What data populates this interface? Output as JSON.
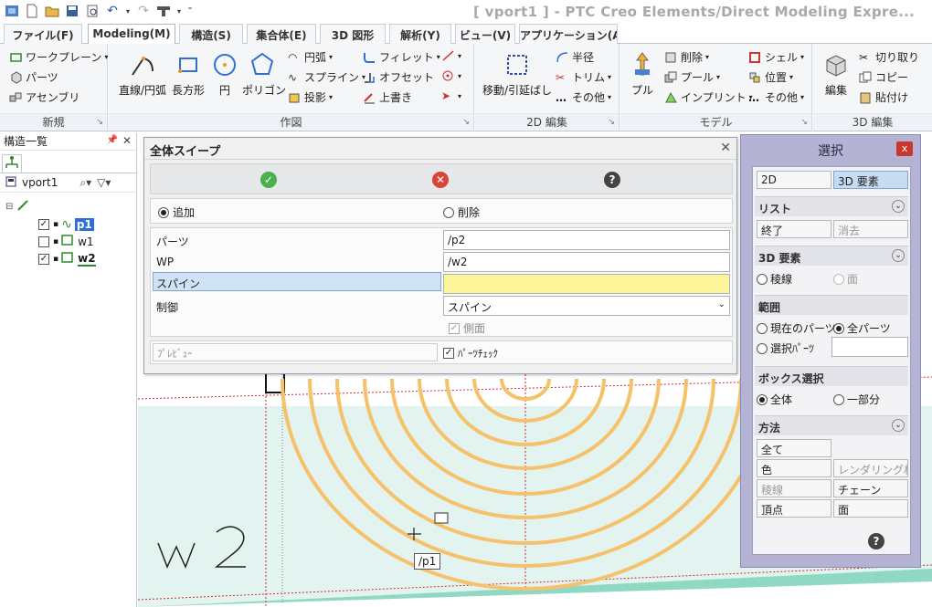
{
  "window": {
    "title": "[ vport1 ] - PTC Creo Elements/Direct Modeling Expre..."
  },
  "tabs": [
    {
      "label": "ファイル(F)"
    },
    {
      "label": "Modeling(M)"
    },
    {
      "label": "構造(S)"
    },
    {
      "label": "集合体(E)"
    },
    {
      "label": "3D 図形"
    },
    {
      "label": "解析(Y)"
    },
    {
      "label": "ビュー(V)"
    },
    {
      "label": "アプリケーション(A)"
    }
  ],
  "ribbon": {
    "groups": {
      "new": "新規",
      "draw": "作図",
      "edit2d": "2D 編集",
      "model": "モデル",
      "edit3d": "3D 編集"
    },
    "new_items": [
      "ワークプレーン",
      "パーツ",
      "アセンブリ"
    ],
    "draw_big": [
      "直線/円弧",
      "長方形",
      "円",
      "ポリゴン"
    ],
    "draw_small": [
      "円弧",
      "スプライン",
      "投影",
      "フィレット",
      "オフセット",
      "上書き"
    ],
    "edit2d_big": "移動/引延ばし",
    "edit2d_small": [
      "半径",
      "トリム",
      "その他"
    ],
    "model_big": "プル",
    "model_small": [
      "削除",
      "プール",
      "インプリント",
      "シェル",
      "位置",
      "その他"
    ],
    "edit3d_big": "編集",
    "edit3d_small": [
      "切り取り",
      "コピー",
      "貼付け"
    ]
  },
  "structure_panel": {
    "title": "構造一覧",
    "viewport": "vport1",
    "tree": [
      {
        "name": "p1",
        "checked": true,
        "selected": true
      },
      {
        "name": "w1",
        "checked": false,
        "selected": false
      },
      {
        "name": "w2",
        "checked": true,
        "selected": false
      }
    ]
  },
  "dialog": {
    "title": "全体スイープ",
    "mode_add": "追加",
    "mode_remove": "削除",
    "fields": {
      "part_label": "パーツ",
      "part_value": "/p2",
      "wp_label": "WP",
      "wp_value": "/w2",
      "spine_label": "スパイン",
      "spine_value": "",
      "control_label": "制御",
      "control_value": "スパイン",
      "side_label": "側面"
    },
    "preview_label": "ﾌﾟﾚﾋﾞｭｰ",
    "partcheck_label": "ﾊﾟｰﾂﾁｪｯｸ"
  },
  "select_panel": {
    "title": "選択",
    "btn_2d": "2D",
    "btn_3d": "3D 要素",
    "list_head": "リスト",
    "list_end": "終了",
    "list_clear": "消去",
    "elem3d_head": "3D 要素",
    "edge": "稜線",
    "face": "面",
    "scope_head": "範囲",
    "current_part": "現在のパーツ",
    "all_parts": "全パーツ",
    "selected_parts": "選択ﾊﾟｰﾂ",
    "box_head": "ボックス選択",
    "box_all": "全体",
    "box_partial": "一部分",
    "method_head": "方法",
    "method_all": "全て",
    "method_color": "色",
    "method_render": "レンダリング材質",
    "method_edge": "稜線",
    "method_chain": "チェーン",
    "method_vertex": "頂点",
    "method_face": "面"
  },
  "viewport": {
    "wp_label": "w2",
    "cursor_tooltip": "/p1"
  },
  "colors": {
    "arc": "#f5c26b",
    "guide": "#cc2b2b",
    "viewport_bg": "#e3f3ef",
    "spine_field": "#fdf59a"
  }
}
